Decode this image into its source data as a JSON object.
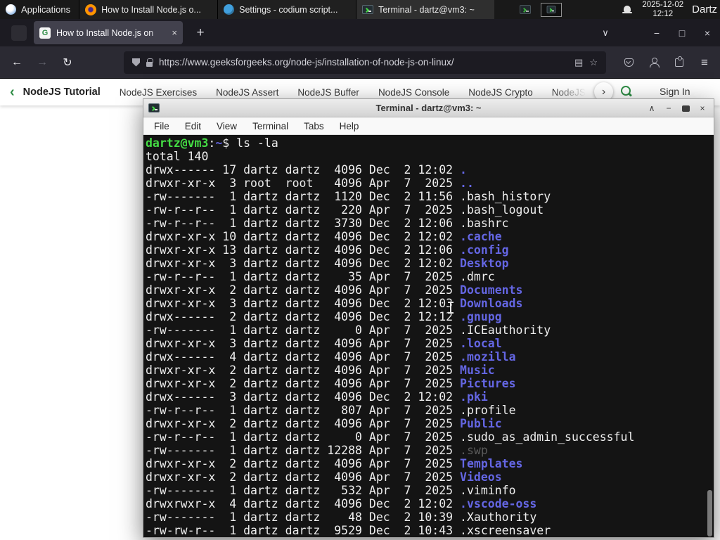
{
  "colors": {
    "panel-bg": "#191919",
    "ff-frame": "#1c1b22",
    "ff-toolbar": "#2b2a33",
    "ff-tab": "#42414d",
    "ff-text": "#fbfbfe",
    "gfg-green": "#2f8d46",
    "term-bg": "#141414",
    "term-fg": "#eeeeee",
    "term-green": "#44dd44",
    "term-blue": "#6466e3",
    "term-dim": "#5a5a5a"
  },
  "icons": {
    "back": "←",
    "forward": "→",
    "reload": "↻",
    "list_tabs": "∨",
    "minimize": "−",
    "maximize": "□",
    "close": "×",
    "new_tab": "+",
    "tab_close": "×",
    "reader": "▤",
    "bookmark": "☆",
    "menu": "≡",
    "nav_prev": "‹",
    "nav_next": "›",
    "term_shade": "∧",
    "term_min": "−",
    "term_close": "×",
    "favicon_text": "G"
  },
  "panel": {
    "applications_label": "Applications",
    "windows": [
      {
        "icon": "firefox",
        "label": "How to Install Node.js o...",
        "active": false
      },
      {
        "icon": "codium",
        "label": "Settings - codium script...",
        "active": false
      },
      {
        "icon": "terminal",
        "label": "Terminal - dartz@vm3: ~",
        "active": true
      }
    ],
    "date": "2025-12-02",
    "time": "12:12",
    "user": "Dartz"
  },
  "browser": {
    "tab_title": "How to Install Node.js on",
    "url": "https://www.geeksforgeeks.org/node-js/installation-of-node-js-on-linux/",
    "site_nav": {
      "items": [
        "NodeJS Tutorial",
        "NodeJS Exercises",
        "NodeJS Assert",
        "NodeJS Buffer",
        "NodeJS Console",
        "NodeJS Crypto",
        "NodeJS DNS",
        "Node"
      ],
      "sign_in": "Sign In"
    }
  },
  "terminal": {
    "title": "Terminal - dartz@vm3: ~",
    "menu": [
      "File",
      "Edit",
      "View",
      "Terminal",
      "Tabs",
      "Help"
    ],
    "prompt": {
      "user_host": "dartz@vm3",
      "separator": ":",
      "path": "~",
      "symbol": "$",
      "command": "ls -la"
    },
    "total_line": "total 140",
    "entries": [
      {
        "perm": "drwx------",
        "links": "17",
        "owner": "dartz",
        "group": "dartz",
        "size": "4096",
        "date": "Dec  2 12:02",
        "name": ".",
        "style": "dir"
      },
      {
        "perm": "drwxr-xr-x",
        "links": "3",
        "owner": "root",
        "group": "root",
        "size": "4096",
        "date": "Apr  7  2025",
        "name": "..",
        "style": "dir"
      },
      {
        "perm": "-rw-------",
        "links": "1",
        "owner": "dartz",
        "group": "dartz",
        "size": "1120",
        "date": "Dec  2 11:56",
        "name": ".bash_history",
        "style": "file"
      },
      {
        "perm": "-rw-r--r--",
        "links": "1",
        "owner": "dartz",
        "group": "dartz",
        "size": "220",
        "date": "Apr  7  2025",
        "name": ".bash_logout",
        "style": "file"
      },
      {
        "perm": "-rw-r--r--",
        "links": "1",
        "owner": "dartz",
        "group": "dartz",
        "size": "3730",
        "date": "Dec  2 12:06",
        "name": ".bashrc",
        "style": "file"
      },
      {
        "perm": "drwxr-xr-x",
        "links": "10",
        "owner": "dartz",
        "group": "dartz",
        "size": "4096",
        "date": "Dec  2 12:02",
        "name": ".cache",
        "style": "dir"
      },
      {
        "perm": "drwxr-xr-x",
        "links": "13",
        "owner": "dartz",
        "group": "dartz",
        "size": "4096",
        "date": "Dec  2 12:06",
        "name": ".config",
        "style": "dir"
      },
      {
        "perm": "drwxr-xr-x",
        "links": "3",
        "owner": "dartz",
        "group": "dartz",
        "size": "4096",
        "date": "Dec  2 12:02",
        "name": "Desktop",
        "style": "dir"
      },
      {
        "perm": "-rw-r--r--",
        "links": "1",
        "owner": "dartz",
        "group": "dartz",
        "size": "35",
        "date": "Apr  7  2025",
        "name": ".dmrc",
        "style": "file"
      },
      {
        "perm": "drwxr-xr-x",
        "links": "2",
        "owner": "dartz",
        "group": "dartz",
        "size": "4096",
        "date": "Apr  7  2025",
        "name": "Documents",
        "style": "dir"
      },
      {
        "perm": "drwxr-xr-x",
        "links": "3",
        "owner": "dartz",
        "group": "dartz",
        "size": "4096",
        "date": "Dec  2 12:03",
        "name": "Downloads",
        "style": "dir"
      },
      {
        "perm": "drwx------",
        "links": "2",
        "owner": "dartz",
        "group": "dartz",
        "size": "4096",
        "date": "Dec  2 12:12",
        "name": ".gnupg",
        "style": "dir"
      },
      {
        "perm": "-rw-------",
        "links": "1",
        "owner": "dartz",
        "group": "dartz",
        "size": "0",
        "date": "Apr  7  2025",
        "name": ".ICEauthority",
        "style": "file"
      },
      {
        "perm": "drwxr-xr-x",
        "links": "3",
        "owner": "dartz",
        "group": "dartz",
        "size": "4096",
        "date": "Apr  7  2025",
        "name": ".local",
        "style": "dir"
      },
      {
        "perm": "drwx------",
        "links": "4",
        "owner": "dartz",
        "group": "dartz",
        "size": "4096",
        "date": "Apr  7  2025",
        "name": ".mozilla",
        "style": "dir"
      },
      {
        "perm": "drwxr-xr-x",
        "links": "2",
        "owner": "dartz",
        "group": "dartz",
        "size": "4096",
        "date": "Apr  7  2025",
        "name": "Music",
        "style": "dir"
      },
      {
        "perm": "drwxr-xr-x",
        "links": "2",
        "owner": "dartz",
        "group": "dartz",
        "size": "4096",
        "date": "Apr  7  2025",
        "name": "Pictures",
        "style": "dir"
      },
      {
        "perm": "drwx------",
        "links": "3",
        "owner": "dartz",
        "group": "dartz",
        "size": "4096",
        "date": "Dec  2 12:02",
        "name": ".pki",
        "style": "dir"
      },
      {
        "perm": "-rw-r--r--",
        "links": "1",
        "owner": "dartz",
        "group": "dartz",
        "size": "807",
        "date": "Apr  7  2025",
        "name": ".profile",
        "style": "file"
      },
      {
        "perm": "drwxr-xr-x",
        "links": "2",
        "owner": "dartz",
        "group": "dartz",
        "size": "4096",
        "date": "Apr  7  2025",
        "name": "Public",
        "style": "dir"
      },
      {
        "perm": "-rw-r--r--",
        "links": "1",
        "owner": "dartz",
        "group": "dartz",
        "size": "0",
        "date": "Apr  7  2025",
        "name": ".sudo_as_admin_successful",
        "style": "file"
      },
      {
        "perm": "-rw-------",
        "links": "1",
        "owner": "dartz",
        "group": "dartz",
        "size": "12288",
        "date": "Apr  7  2025",
        "name": ".swp",
        "style": "dim"
      },
      {
        "perm": "drwxr-xr-x",
        "links": "2",
        "owner": "dartz",
        "group": "dartz",
        "size": "4096",
        "date": "Apr  7  2025",
        "name": "Templates",
        "style": "dir"
      },
      {
        "perm": "drwxr-xr-x",
        "links": "2",
        "owner": "dartz",
        "group": "dartz",
        "size": "4096",
        "date": "Apr  7  2025",
        "name": "Videos",
        "style": "dir"
      },
      {
        "perm": "-rw-------",
        "links": "1",
        "owner": "dartz",
        "group": "dartz",
        "size": "532",
        "date": "Apr  7  2025",
        "name": ".viminfo",
        "style": "file"
      },
      {
        "perm": "drwxrwxr-x",
        "links": "4",
        "owner": "dartz",
        "group": "dartz",
        "size": "4096",
        "date": "Dec  2 12:02",
        "name": ".vscode-oss",
        "style": "dir"
      },
      {
        "perm": "-rw-------",
        "links": "1",
        "owner": "dartz",
        "group": "dartz",
        "size": "48",
        "date": "Dec  2 10:39",
        "name": ".Xauthority",
        "style": "file"
      },
      {
        "perm": "-rw-rw-r--",
        "links": "1",
        "owner": "dartz",
        "group": "dartz",
        "size": "9529",
        "date": "Dec  2 10:43",
        "name": ".xscreensaver",
        "style": "file"
      }
    ]
  }
}
